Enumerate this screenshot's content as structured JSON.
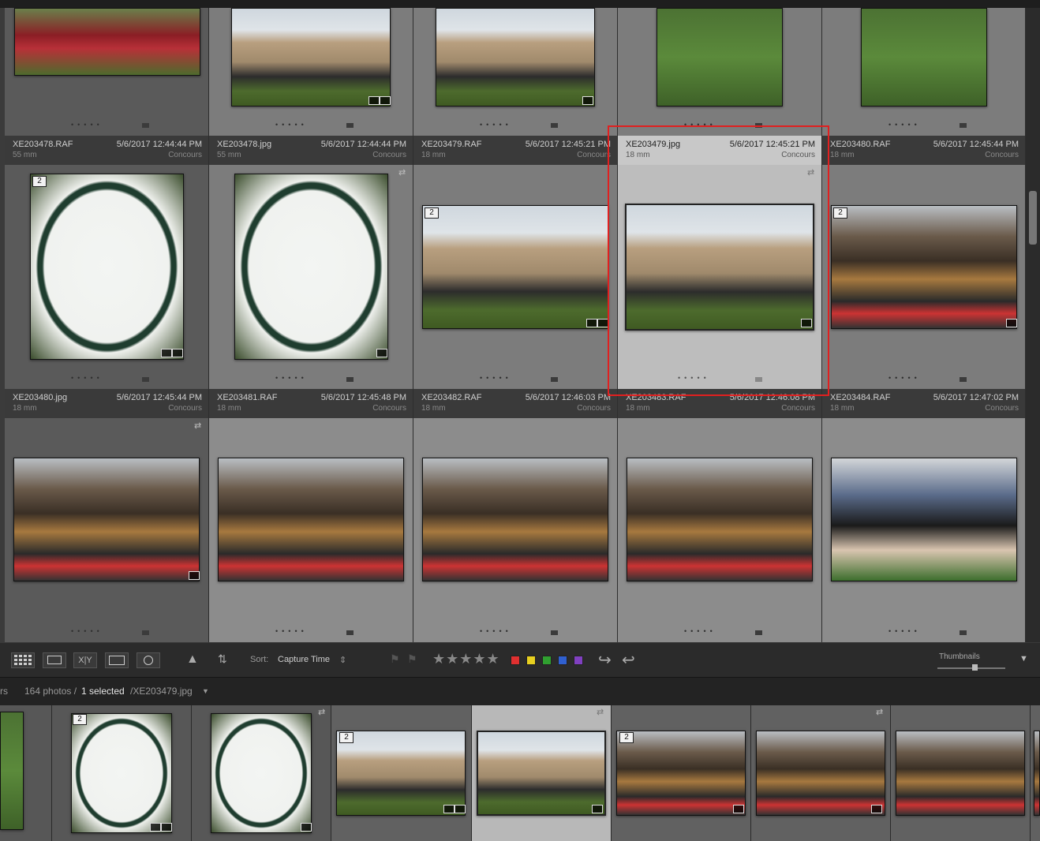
{
  "grid": {
    "rows": [
      {
        "cells": [
          {
            "name": "XE203478.RAF",
            "date": "5/6/2017 12:44:44 PM",
            "lens": "55 mm",
            "place": "Concours",
            "stack": "2"
          },
          {
            "name": "XE203478.jpg",
            "date": "5/6/2017 12:44:44 PM",
            "lens": "55 mm",
            "place": "Concours",
            "stack": ""
          },
          {
            "name": "XE203479.RAF",
            "date": "5/6/2017 12:45:21 PM",
            "lens": "18 mm",
            "place": "Concours",
            "stack": "2"
          },
          {
            "name": "XE203479.jpg",
            "date": "5/6/2017 12:45:21 PM",
            "lens": "18 mm",
            "place": "Concours",
            "stack": ""
          },
          {
            "name": "XE203480.RAF",
            "date": "5/6/2017 12:45:44 PM",
            "lens": "18 mm",
            "place": "Concours",
            "stack": "2"
          }
        ]
      },
      {
        "cells": [
          {
            "name": "XE203480.jpg",
            "date": "5/6/2017 12:45:44 PM",
            "lens": "18 mm",
            "place": "Concours"
          },
          {
            "name": "XE203481.RAF",
            "date": "5/6/2017 12:45:48 PM",
            "lens": "18 mm",
            "place": "Concours"
          },
          {
            "name": "XE203482.RAF",
            "date": "5/6/2017 12:46:03 PM",
            "lens": "18 mm",
            "place": "Concours"
          },
          {
            "name": "XE203483.RAF",
            "date": "5/6/2017 12:46:08 PM",
            "lens": "18 mm",
            "place": "Concours"
          },
          {
            "name": "XE203484.RAF",
            "date": "5/6/2017 12:47:02 PM",
            "lens": "18 mm",
            "place": "Concours"
          }
        ]
      }
    ]
  },
  "toolbar": {
    "sort_label": "Sort:",
    "sort_value": "Capture Time",
    "sort_arrow": "⇕",
    "stars": "★★★★★",
    "thumbnails_label": "Thumbnails",
    "view_grid_icon": "grid-icon",
    "colors": {
      "red": "#e03030",
      "yellow": "#e8d020",
      "green": "#30a030",
      "blue": "#3060d0",
      "purple": "#8040c0"
    }
  },
  "filmstrip": {
    "left_label": "rs",
    "count": "164 photos /",
    "selected": "1 selected",
    "filename": "/XE203479.jpg",
    "dropdown": "▼",
    "stacks": [
      "2",
      "2",
      "2"
    ]
  },
  "icons": {
    "sync": "⇄",
    "badge": "⧉"
  }
}
